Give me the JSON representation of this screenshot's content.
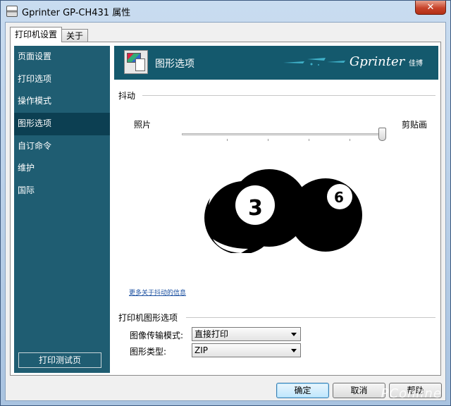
{
  "window": {
    "title": "Gprinter GP-CH431 属性",
    "close_label": "✕"
  },
  "tabs": [
    {
      "label": "打印机设置",
      "active": true
    },
    {
      "label": "关于",
      "active": false
    }
  ],
  "sidebar": {
    "items": [
      {
        "label": "页面设置"
      },
      {
        "label": "打印选项"
      },
      {
        "label": "操作模式"
      },
      {
        "label": "图形选项",
        "active": true
      },
      {
        "label": "自订命令"
      },
      {
        "label": "维护"
      },
      {
        "label": "国际"
      }
    ],
    "test_print_button": "打印测试页"
  },
  "header": {
    "title": "图形选项",
    "brand": "Gprinter",
    "brand_cn": "佳博",
    "header_color": "#14596d"
  },
  "dither": {
    "section_title": "抖动",
    "left_label": "照片",
    "right_label": "剪贴画",
    "slider_value_fraction": 1.0,
    "more_info_link": "更多关于抖动的信息"
  },
  "printer_graphics": {
    "section_title": "打印机图形选项",
    "transfer_mode_label": "图像传输模式:",
    "transfer_mode_value": "直接打印",
    "graphic_type_label": "图形类型:",
    "graphic_type_value": "ZIP"
  },
  "footer": {
    "ok": "确定",
    "cancel": "取消",
    "help": "帮助"
  },
  "watermark": "PConline"
}
